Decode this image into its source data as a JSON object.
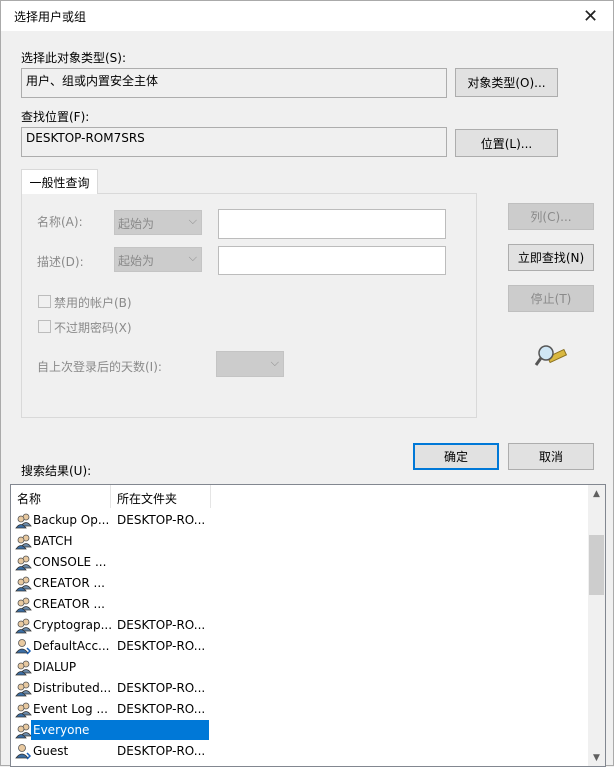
{
  "window": {
    "title": "选择用户或组",
    "close_glyph": "✕"
  },
  "object_type": {
    "label": "选择此对象类型(S):",
    "value": "用户、组或内置安全主体",
    "button": "对象类型(O)..."
  },
  "location": {
    "label": "查找位置(F):",
    "value": "DESKTOP-ROM7SRS",
    "button": "位置(L)..."
  },
  "query_tab": {
    "tab_label": "一般性查询",
    "name_label": "名称(A):",
    "name_mode": "起始为",
    "desc_label": "描述(D):",
    "desc_mode": "起始为",
    "disabled_accounts": "禁用的帐户(B)",
    "non_expiring": "不过期密码(X)",
    "days_since_login": "自上次登录后的天数(I):"
  },
  "side_buttons": {
    "columns": "列(C)...",
    "find_now": "立即查找(N)",
    "stop": "停止(T)"
  },
  "dialog_buttons": {
    "ok": "确定",
    "cancel": "取消"
  },
  "results": {
    "label": "搜索结果(U):",
    "columns": [
      "名称",
      "所在文件夹"
    ],
    "rows": [
      {
        "name": "Backup Op...",
        "folder": "DESKTOP-RO...",
        "icon": "group-icon"
      },
      {
        "name": "BATCH",
        "folder": "",
        "icon": "group-icon"
      },
      {
        "name": "CONSOLE ...",
        "folder": "",
        "icon": "group-icon"
      },
      {
        "name": "CREATOR ...",
        "folder": "",
        "icon": "group-icon"
      },
      {
        "name": "CREATOR ...",
        "folder": "",
        "icon": "group-icon"
      },
      {
        "name": "Cryptograp...",
        "folder": "DESKTOP-RO...",
        "icon": "group-icon"
      },
      {
        "name": "DefaultAcc...",
        "folder": "DESKTOP-RO...",
        "icon": "user-icon"
      },
      {
        "name": "DIALUP",
        "folder": "",
        "icon": "group-icon"
      },
      {
        "name": "Distributed...",
        "folder": "DESKTOP-RO...",
        "icon": "group-icon"
      },
      {
        "name": "Event Log ...",
        "folder": "DESKTOP-RO...",
        "icon": "group-icon"
      },
      {
        "name": "Everyone",
        "folder": "",
        "icon": "group-icon",
        "selected": true
      },
      {
        "name": "Guest",
        "folder": "DESKTOP-RO...",
        "icon": "user-icon"
      }
    ]
  }
}
